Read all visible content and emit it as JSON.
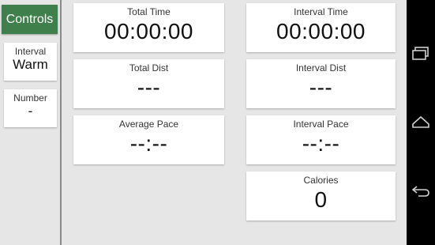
{
  "controls_label": "Controls",
  "sidebar": {
    "interval": {
      "label": "Interval",
      "value": "Warm"
    },
    "number": {
      "label": "Number",
      "value": "-"
    }
  },
  "cards": {
    "total_time": {
      "label": "Total Time",
      "value": "00:00:00"
    },
    "interval_time": {
      "label": "Interval Time",
      "value": "00:00:00"
    },
    "total_dist": {
      "label": "Total Dist",
      "value": "---"
    },
    "interval_dist": {
      "label": "Interval Dist",
      "value": "---"
    },
    "average_pace": {
      "label": "Average Pace",
      "value": "--:--"
    },
    "interval_pace": {
      "label": "Interval Pace",
      "value": "--:--"
    },
    "calories": {
      "label": "Calories",
      "value": "0"
    }
  },
  "navbar": {
    "icons": [
      "recent-apps-icon",
      "home-icon",
      "back-icon"
    ]
  },
  "colors": {
    "accent_green": "#3f7f4b",
    "background": "#e6e6e6",
    "card": "#ffffff",
    "navbar": "#000000"
  }
}
